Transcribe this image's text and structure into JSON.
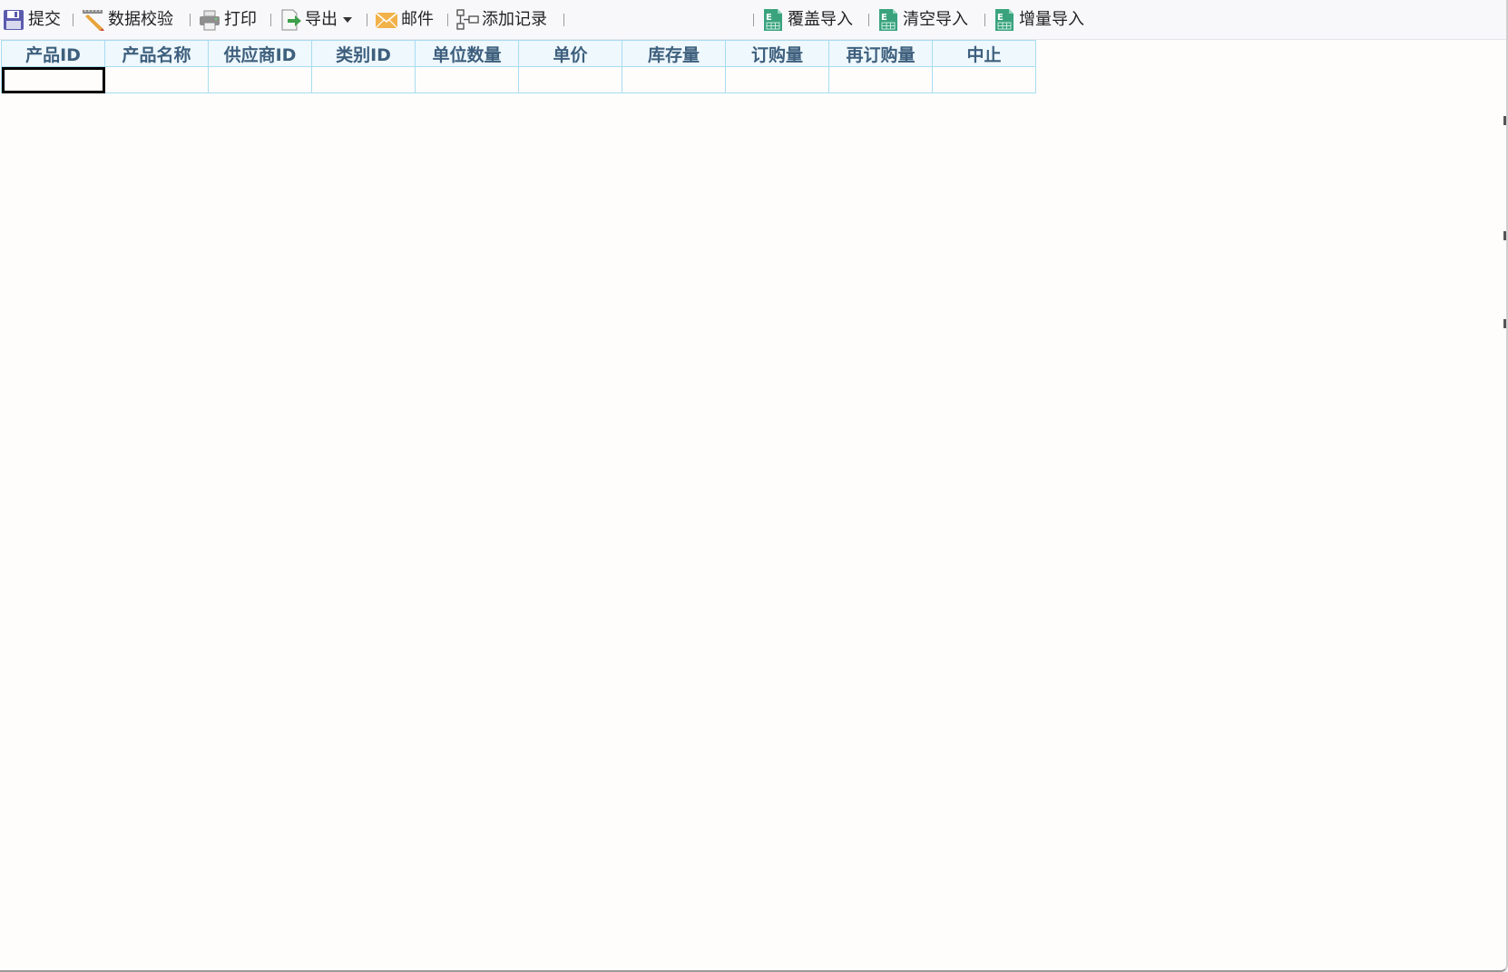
{
  "toolbar": {
    "submit": {
      "label": "提交",
      "icon": "save-icon"
    },
    "validate": {
      "label": "数据校验",
      "icon": "pencil-ruler-icon"
    },
    "print": {
      "label": "打印",
      "icon": "printer-icon"
    },
    "export": {
      "label": "导出",
      "icon": "export-icon"
    },
    "mail": {
      "label": "邮件",
      "icon": "envelope-icon"
    },
    "add_record": {
      "label": "添加记录",
      "icon": "add-record-icon"
    },
    "overwrite_import": {
      "label": "覆盖导入",
      "icon": "excel-icon"
    },
    "clear_import": {
      "label": "清空导入",
      "icon": "excel-icon"
    },
    "incremental_import": {
      "label": "增量导入",
      "icon": "excel-icon"
    }
  },
  "grid": {
    "columns": [
      "产品ID",
      "产品名称",
      "供应商ID",
      "类别ID",
      "单位数量",
      "单价",
      "库存量",
      "订购量",
      "再订购量",
      "中止"
    ],
    "rows": [
      [
        "",
        "",
        "",
        "",
        "",
        "",
        "",
        "",
        "",
        ""
      ]
    ],
    "selected_cell": {
      "row": 0,
      "col": 0
    }
  },
  "colors": {
    "header_bg": "#eef8fd",
    "header_text": "#3e5f7d",
    "grid_border": "#a9dcf0",
    "excel_icon": "#3aa37e"
  }
}
